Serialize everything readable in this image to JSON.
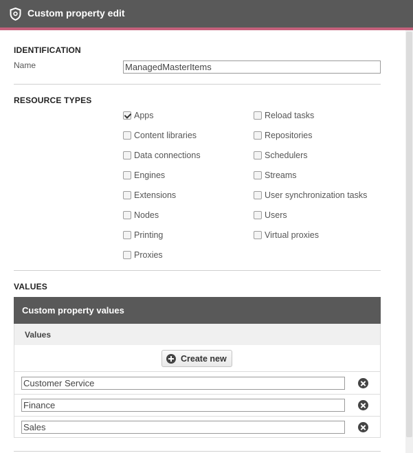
{
  "window": {
    "title": "Custom property edit",
    "icon": "shield-icon",
    "accent_color": "#c5607b",
    "header_color": "#595959"
  },
  "identification": {
    "heading": "IDENTIFICATION",
    "name_label": "Name",
    "name_value": "ManagedMasterItems"
  },
  "resource_types": {
    "heading": "RESOURCE TYPES",
    "column1": [
      {
        "label": "Apps",
        "checked": true
      },
      {
        "label": "Content libraries",
        "checked": false
      },
      {
        "label": "Data connections",
        "checked": false
      },
      {
        "label": "Engines",
        "checked": false
      },
      {
        "label": "Extensions",
        "checked": false
      },
      {
        "label": "Nodes",
        "checked": false
      },
      {
        "label": "Printing",
        "checked": false
      },
      {
        "label": "Proxies",
        "checked": false
      }
    ],
    "column2": [
      {
        "label": "Reload tasks",
        "checked": false
      },
      {
        "label": "Repositories",
        "checked": false
      },
      {
        "label": "Schedulers",
        "checked": false
      },
      {
        "label": "Streams",
        "checked": false
      },
      {
        "label": "User synchronization tasks",
        "checked": false
      },
      {
        "label": "Users",
        "checked": false
      },
      {
        "label": "Virtual proxies",
        "checked": false
      }
    ]
  },
  "values": {
    "heading": "VALUES",
    "panel_title": "Custom property values",
    "column_header": "Values",
    "create_label": "Create new",
    "items": [
      "Customer Service",
      "Finance",
      "Sales"
    ]
  }
}
